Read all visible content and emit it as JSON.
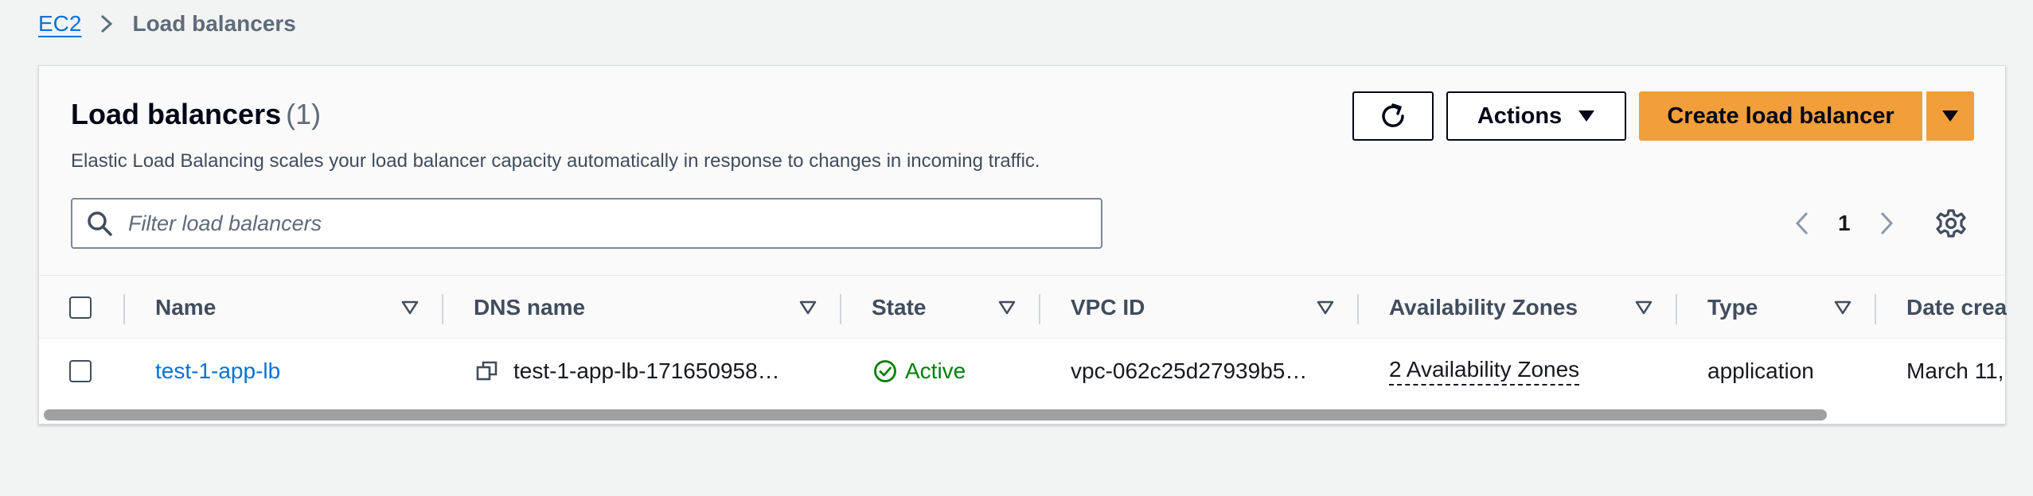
{
  "breadcrumb": {
    "root": "EC2",
    "current": "Load balancers"
  },
  "header": {
    "title": "Load balancers",
    "count": "(1)",
    "description": "Elastic Load Balancing scales your load balancer capacity automatically in response to changes in incoming traffic.",
    "actions_label": "Actions",
    "create_label": "Create load balancer"
  },
  "search": {
    "placeholder": "Filter load balancers",
    "value": ""
  },
  "pagination": {
    "current_page": "1"
  },
  "table": {
    "columns": [
      "Name",
      "DNS name",
      "State",
      "VPC ID",
      "Availability Zones",
      "Type",
      "Date crea"
    ],
    "rows": [
      {
        "name": "test-1-app-lb",
        "dns_name": "test-1-app-lb-171650958…",
        "state": "Active",
        "vpc_id": "vpc-062c25d27939b5…",
        "availability_zones": "2 Availability Zones",
        "type": "application",
        "date_created": "March 11,"
      }
    ]
  },
  "icons": {
    "breadcrumb_separator": "chevron-right-icon",
    "refresh": "refresh-icon",
    "dropdown": "caret-down-icon",
    "search": "search-icon",
    "prev": "chevron-left-icon",
    "next": "chevron-right-icon",
    "settings": "gear-icon",
    "copy": "copy-icon",
    "status": "check-circle-icon",
    "sort": "sort-caret-icon"
  },
  "colors": {
    "link": "#0972d3",
    "primary_button": "#f29e3a",
    "status_active": "#037f0c",
    "background": "#f2f3f3"
  }
}
